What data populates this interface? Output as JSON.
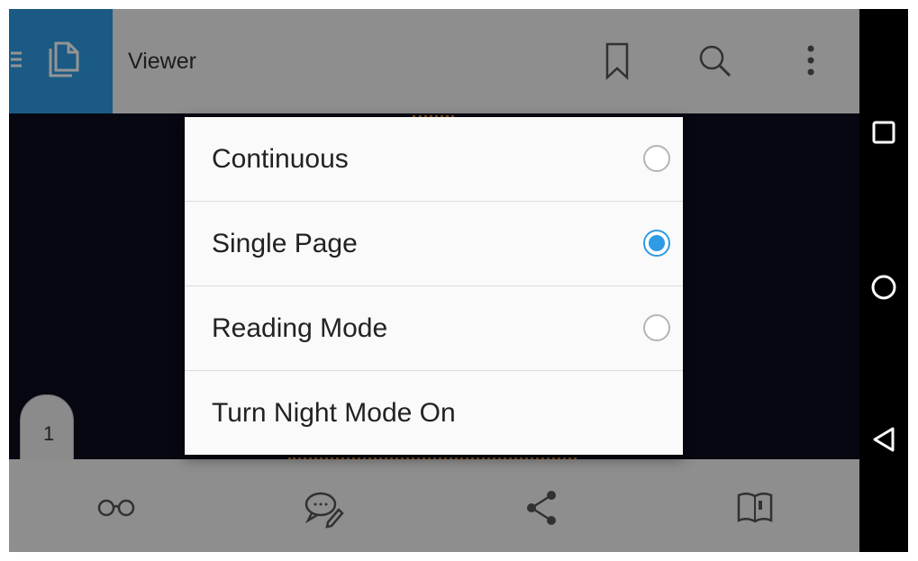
{
  "header": {
    "title": "Viewer",
    "accent_color": "#2e9be3",
    "icons": [
      "hamburger-icon",
      "documents-icon",
      "bookmark-icon",
      "search-icon",
      "more-vert-icon"
    ]
  },
  "document": {
    "page_tab_label": "1"
  },
  "view_mode_menu": {
    "items": [
      {
        "label": "Continuous",
        "type": "radio",
        "selected": false
      },
      {
        "label": "Single Page",
        "type": "radio",
        "selected": true
      },
      {
        "label": "Reading Mode",
        "type": "radio",
        "selected": false
      },
      {
        "label": "Turn Night Mode On",
        "type": "action"
      }
    ]
  },
  "bottom_toolbar": {
    "icons": [
      "reading-glasses-icon",
      "annotate-icon",
      "share-icon",
      "outline-book-icon"
    ]
  },
  "system_nav": {
    "icons": [
      "recents-square-icon",
      "home-circle-icon",
      "back-triangle-icon"
    ]
  }
}
